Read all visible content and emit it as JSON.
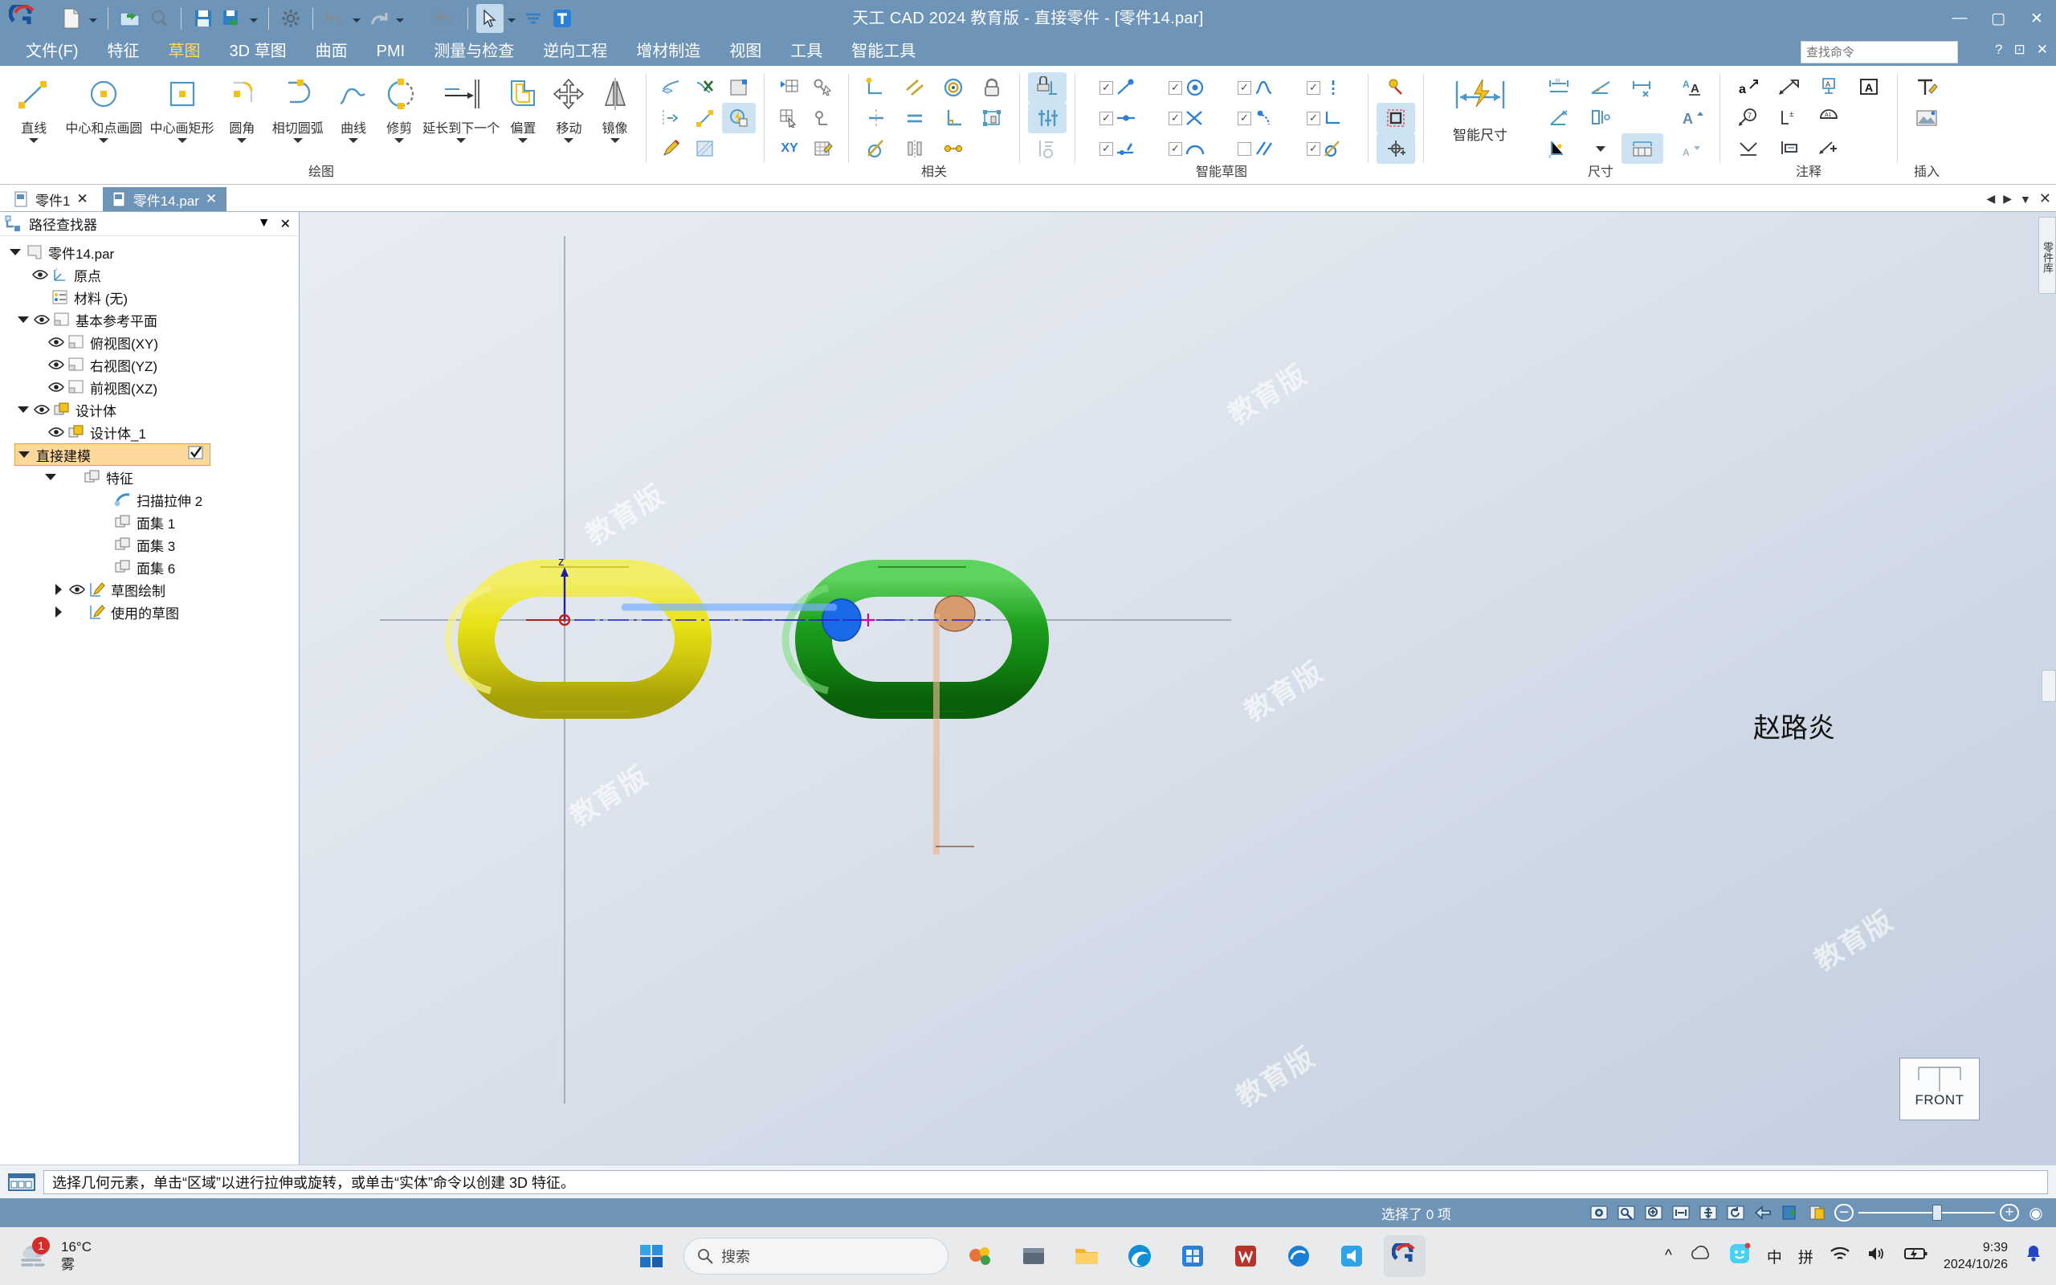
{
  "window": {
    "title": "天工 CAD 2024 教育版 - 直接零件 - [零件14.par]",
    "minimize": "—",
    "maximize": "▢",
    "close": "✕"
  },
  "quick_access": {
    "new_label": "新建",
    "open_label": "打开",
    "print_preview_label": "打印预览",
    "save_label": "保存",
    "save_as_label": "另存为",
    "options_label": "选项",
    "undo_label": "撤消",
    "redo_label": "重做",
    "repeat_label": "重复",
    "select_label": "选择",
    "text_label": "文本"
  },
  "menu": {
    "items": [
      {
        "label": "文件(F)",
        "active": false
      },
      {
        "label": "特征",
        "active": false
      },
      {
        "label": "草图",
        "active": true
      },
      {
        "label": "3D 草图",
        "active": false
      },
      {
        "label": "曲面",
        "active": false
      },
      {
        "label": "PMI",
        "active": false
      },
      {
        "label": "测量与检查",
        "active": false
      },
      {
        "label": "逆向工程",
        "active": false
      },
      {
        "label": "增材制造",
        "active": false
      },
      {
        "label": "视图",
        "active": false
      },
      {
        "label": "工具",
        "active": false
      },
      {
        "label": "智能工具",
        "active": false
      }
    ],
    "search_placeholder": "查找命令",
    "help_label": "?",
    "restore_label": "⊡",
    "close_label": "✕"
  },
  "ribbon": {
    "groups": [
      {
        "name": "绘图",
        "label": "绘图",
        "buttons": [
          {
            "label": "直线",
            "icon": "line-icon",
            "dropdown": true
          },
          {
            "label": "中心和点画圆",
            "icon": "circle-center-point-icon",
            "dropdown": true
          },
          {
            "label": "中心画矩形",
            "icon": "rectangle-center-icon",
            "dropdown": true
          },
          {
            "label": "圆角",
            "icon": "fillet-icon",
            "dropdown": true
          },
          {
            "label": "相切圆弧",
            "icon": "tangent-arc-icon",
            "dropdown": true
          },
          {
            "label": "曲线",
            "icon": "curve-icon",
            "dropdown": true
          },
          {
            "label": "修剪",
            "icon": "trim-icon",
            "dropdown": true
          },
          {
            "label": "延长到下一个",
            "icon": "extend-to-next-icon",
            "dropdown": true
          },
          {
            "label": "偏置",
            "icon": "offset-icon",
            "dropdown": true
          },
          {
            "label": "移动",
            "icon": "move-icon",
            "dropdown": true
          },
          {
            "label": "镜像",
            "icon": "mirror-icon",
            "dropdown": true
          }
        ]
      },
      {
        "name": "相关",
        "label": "相关",
        "small_icons": [
          "project-curve-icon",
          "delete-relation-icon",
          "region-icon",
          "split-icon",
          "convert-icon",
          "relate-flash-icon",
          "pencil-edit-icon",
          "hatch-icon",
          "grid-point-icon",
          "pick-point-icon",
          "grid-select-icon",
          "axis-icon",
          "xy-icon",
          "edit-grid-icon",
          "connect-icon",
          "parallel-icon",
          "concentric-icon",
          "lock-icon",
          "symmetric-icon",
          "equal-icon",
          "perpendicular-icon",
          "rigid-set-icon",
          "tangent-icon",
          "symmetric-axis-icon",
          "collinear-icon",
          "auto-dim-icon",
          "variable-icon",
          "relation-assist-icon"
        ]
      },
      {
        "name": "智能草图",
        "label": "智能草图",
        "checkboxes": [
          {
            "checked": true,
            "icon": "endpoint-icon"
          },
          {
            "checked": true,
            "icon": "center-point-icon"
          },
          {
            "checked": true,
            "icon": "midpoint-icon"
          },
          {
            "checked": true,
            "icon": "vertical-icon"
          },
          {
            "checked": true,
            "icon": "point-on-icon"
          },
          {
            "checked": true,
            "icon": "intersection-icon"
          },
          {
            "checked": true,
            "icon": "tangent-pt-icon"
          },
          {
            "checked": true,
            "icon": "horizontal-icon"
          },
          {
            "checked": true,
            "icon": "collinear-pt-icon"
          },
          {
            "checked": true,
            "icon": "arc-icon"
          },
          {
            "checked": false,
            "icon": "parallel-lines-icon"
          },
          {
            "checked": true,
            "icon": "tangent-circle-icon"
          }
        ],
        "extra_icons": [
          "idea-icon",
          "select-region-icon",
          "add-point-icon"
        ]
      },
      {
        "name": "智能尺寸",
        "label": "智能尺寸",
        "button_label": "智能尺寸",
        "icon": "smart-dimension-icon"
      },
      {
        "name": "尺寸",
        "label": "尺寸",
        "small_icons": [
          "distance-between-icon",
          "angle-between-icon",
          "coordinate-dim-icon",
          "symmetric-diameter-icon",
          "dimension-axis-icon",
          "xy-coordinate-icon",
          "dimension-group-icon"
        ]
      },
      {
        "name": "字体",
        "label": "",
        "small_icons": [
          "font-style-icon",
          "font-grow-icon",
          "font-shrink-icon"
        ]
      },
      {
        "name": "注释",
        "label": "注释",
        "small_icons": [
          "leader-text-icon",
          "balloon-arrow-icon",
          "datum-frame-icon",
          "label-a-icon",
          "callout-icon",
          "tolerance-icon",
          "surface-finish-icon",
          "weld-icon",
          "note-icon",
          "feature-control-icon"
        ]
      },
      {
        "name": "插入",
        "label": "插入",
        "small_icons": [
          "insert-text-icon",
          "insert-image-icon"
        ]
      }
    ]
  },
  "doc_tabs": {
    "tabs": [
      {
        "label": "零件1",
        "active": false,
        "close": "✕"
      },
      {
        "label": "零件14.par",
        "active": true,
        "close": "✕"
      }
    ],
    "nav_prev": "◀",
    "nav_next": "▶",
    "nav_down": "▼",
    "nav_close": "✕"
  },
  "pathfinder": {
    "title": "路径查找器",
    "menu_icon": "▼",
    "close_icon": "✕",
    "tree": [
      {
        "label": "零件14.par",
        "indent": 0,
        "toggle": "down",
        "eye": false,
        "icon": "part-icon",
        "highlight": false
      },
      {
        "label": "原点",
        "indent": 1,
        "toggle": "none",
        "eye": true,
        "icon": "origin-icon",
        "highlight": false
      },
      {
        "label": "材料 (无)",
        "indent": 1,
        "toggle": "none",
        "eye": false,
        "icon": "material-icon",
        "highlight": false
      },
      {
        "label": "基本参考平面",
        "indent": 1,
        "toggle": "down",
        "eye": true,
        "icon": "plane-icon",
        "highlight": false
      },
      {
        "label": "俯视图(XY)",
        "indent": 2,
        "toggle": "none",
        "eye": true,
        "icon": "plane-icon",
        "highlight": false
      },
      {
        "label": "右视图(YZ)",
        "indent": 2,
        "toggle": "none",
        "eye": true,
        "icon": "plane-icon",
        "highlight": false
      },
      {
        "label": "前视图(XZ)",
        "indent": 2,
        "toggle": "none",
        "eye": true,
        "icon": "plane-icon",
        "highlight": false
      },
      {
        "label": "设计体",
        "indent": 1,
        "toggle": "down",
        "eye": true,
        "icon": "body-icon",
        "highlight": false
      },
      {
        "label": "设计体_1",
        "indent": 2,
        "toggle": "none",
        "eye": true,
        "icon": "body-icon",
        "highlight": false
      },
      {
        "label": "直接建模",
        "indent": 1,
        "toggle": "down",
        "eye": false,
        "icon": "none",
        "highlight": true,
        "check": true
      },
      {
        "label": "特征",
        "indent": 2,
        "toggle": "down",
        "eye": false,
        "icon": "feature-icon",
        "highlight": false
      },
      {
        "label": "扫描拉伸 2",
        "indent": 3,
        "toggle": "none",
        "eye": false,
        "icon": "sweep-icon",
        "highlight": false
      },
      {
        "label": "面集 1",
        "indent": 3,
        "toggle": "none",
        "eye": false,
        "icon": "faceset-icon",
        "highlight": false
      },
      {
        "label": "面集 3",
        "indent": 3,
        "toggle": "none",
        "eye": false,
        "icon": "faceset-icon",
        "highlight": false
      },
      {
        "label": "面集 6",
        "indent": 3,
        "toggle": "none",
        "eye": false,
        "icon": "faceset-icon",
        "highlight": false
      },
      {
        "label": "草图绘制",
        "indent": 2,
        "toggle": "right",
        "eye": true,
        "icon": "sketch-icon",
        "highlight": false
      },
      {
        "label": "使用的草图",
        "indent": 2,
        "toggle": "right",
        "eye": false,
        "icon": "sketch-icon",
        "highlight": false
      }
    ]
  },
  "viewport": {
    "watermarks": [
      "教育版",
      "教育版",
      "教育版",
      "教育版",
      "教育版",
      "教育版"
    ],
    "username": "赵路炎",
    "viewcube_label": "FRONT",
    "axis_z_label": "z",
    "side_tab_label": "零件库",
    "model_colors": {
      "yellow_link": "#e8e215",
      "green_link": "#1ca01c",
      "blue_link": "#1560e0",
      "copper_link": "#c88048"
    }
  },
  "prompt": {
    "icon": "command-prompt-icon",
    "text": "选择几何元素，单击“区域”以进行拉伸或旋转，或单击“实体”命令以创建 3D 特征。"
  },
  "status": {
    "selection_text": "选择了 0 项",
    "tools": [
      "camera-icon",
      "fit-window-icon",
      "zoom-area-icon",
      "zoom-fit-icon",
      "pan-icon",
      "rotate-icon",
      "look-at-icon",
      "render-icon",
      "display-icon"
    ],
    "zoom_minus": "−",
    "zoom_plus": "+",
    "zoom_reset": "◉"
  },
  "taskbar": {
    "weather_temp": "16°C",
    "weather_desc": "雾",
    "weather_badge": "1",
    "search_placeholder": "搜索",
    "apps": [
      "start-icon",
      "widgets-icon",
      "file-explorer-icon",
      "folder-icon",
      "edge-icon",
      "store-icon",
      "wps-icon",
      "browser-icon",
      "volume-app-icon",
      "cad-icon"
    ],
    "tray": {
      "chevron": "^",
      "cloud_icon": "cloud-icon",
      "chat_icon": "chat-icon",
      "ime_mode": "中",
      "ime_pinyin": "拼",
      "wifi_icon": "wifi-icon",
      "speaker_icon": "speaker-icon",
      "battery_icon": "battery-icon",
      "time": "9:39",
      "date": "2024/10/26",
      "notification_icon": "bell-icon"
    }
  }
}
